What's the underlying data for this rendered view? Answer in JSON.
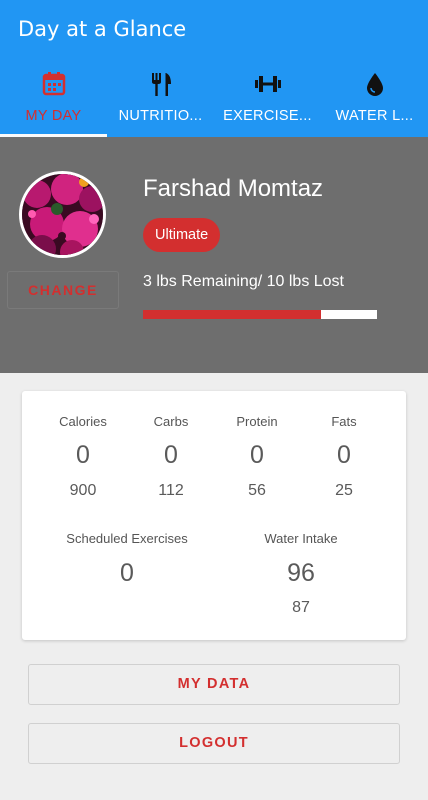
{
  "app": {
    "title": "Day at a Glance"
  },
  "tabs": [
    {
      "label": "MY DAY",
      "icon": "calendar-icon"
    },
    {
      "label": "NUTRITIO...",
      "icon": "fork-knife-icon"
    },
    {
      "label": "EXERCISE...",
      "icon": "dumbbell-icon"
    },
    {
      "label": "WATER L...",
      "icon": "water-drop-icon"
    }
  ],
  "profile": {
    "name": "Farshad Momtaz",
    "badge": "Ultimate",
    "change_label": "CHANGE",
    "remaining_text": "3 lbs Remaining/ 10 lbs Lost",
    "progress_fraction": 0.76
  },
  "summary": {
    "macros": [
      {
        "name": "Calories",
        "value": "0",
        "goal": "900"
      },
      {
        "name": "Carbs",
        "value": "0",
        "goal": "112"
      },
      {
        "name": "Protein",
        "value": "0",
        "goal": "56"
      },
      {
        "name": "Fats",
        "value": "0",
        "goal": "25"
      }
    ],
    "exercises": {
      "name": "Scheduled Exercises",
      "value": "0"
    },
    "water": {
      "name": "Water Intake",
      "value": "96",
      "goal": "87"
    }
  },
  "buttons": {
    "my_data": "MY DATA",
    "logout": "LOGOUT"
  },
  "colors": {
    "primary": "#2196f3",
    "accent": "#d32f2f",
    "profile_bg": "#6e6e6e"
  }
}
